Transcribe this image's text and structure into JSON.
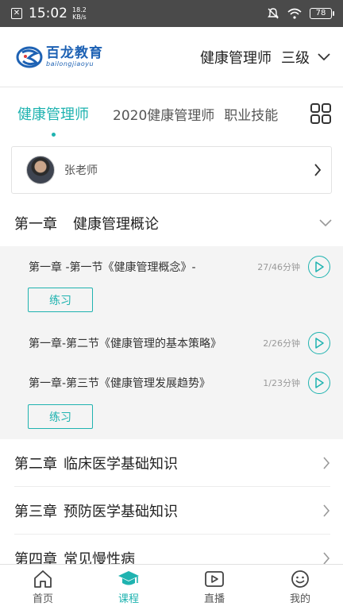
{
  "status_bar": {
    "time": "15:02",
    "speed_value": "18.2",
    "speed_unit": "KB/s",
    "battery": "78"
  },
  "header": {
    "logo_name": "百龙教育",
    "logo_pinyin": "bailongjiaoyu",
    "course": "健康管理师",
    "level": "三级"
  },
  "tabs": [
    {
      "label": "健康管理师",
      "active": true
    },
    {
      "label": "2020健康管理师",
      "active": false
    },
    {
      "label": "职业技能",
      "active": false
    }
  ],
  "teacher": {
    "name": "张老师"
  },
  "chapter_open": {
    "number": "第一章",
    "title": "健康管理概论"
  },
  "lessons": [
    {
      "title": "第一章 -第一节《健康管理概念》-",
      "progress": "27/46分钟",
      "practice": "练习"
    },
    {
      "title": "第一章-第二节《健康管理的基本策略》",
      "progress": "2/26分钟"
    },
    {
      "title": "第一章-第三节《健康管理发展趋势》",
      "progress": "1/23分钟",
      "practice": "练习"
    }
  ],
  "chapters": [
    {
      "number": "第二章",
      "title": "临床医学基础知识"
    },
    {
      "number": "第三章",
      "title": "预防医学基础知识"
    },
    {
      "number": "第四章",
      "title": "常见慢性病"
    }
  ],
  "bottom_nav": [
    {
      "label": "首页",
      "icon": "home-icon",
      "active": false
    },
    {
      "label": "课程",
      "icon": "graduation-cap-icon",
      "active": true
    },
    {
      "label": "直播",
      "icon": "live-play-icon",
      "active": false
    },
    {
      "label": "我的",
      "icon": "smiley-icon",
      "active": false
    }
  ],
  "colors": {
    "accent": "#1fb3b0",
    "brand": "#1e62b4",
    "status_bar": "#4a4a4a"
  }
}
